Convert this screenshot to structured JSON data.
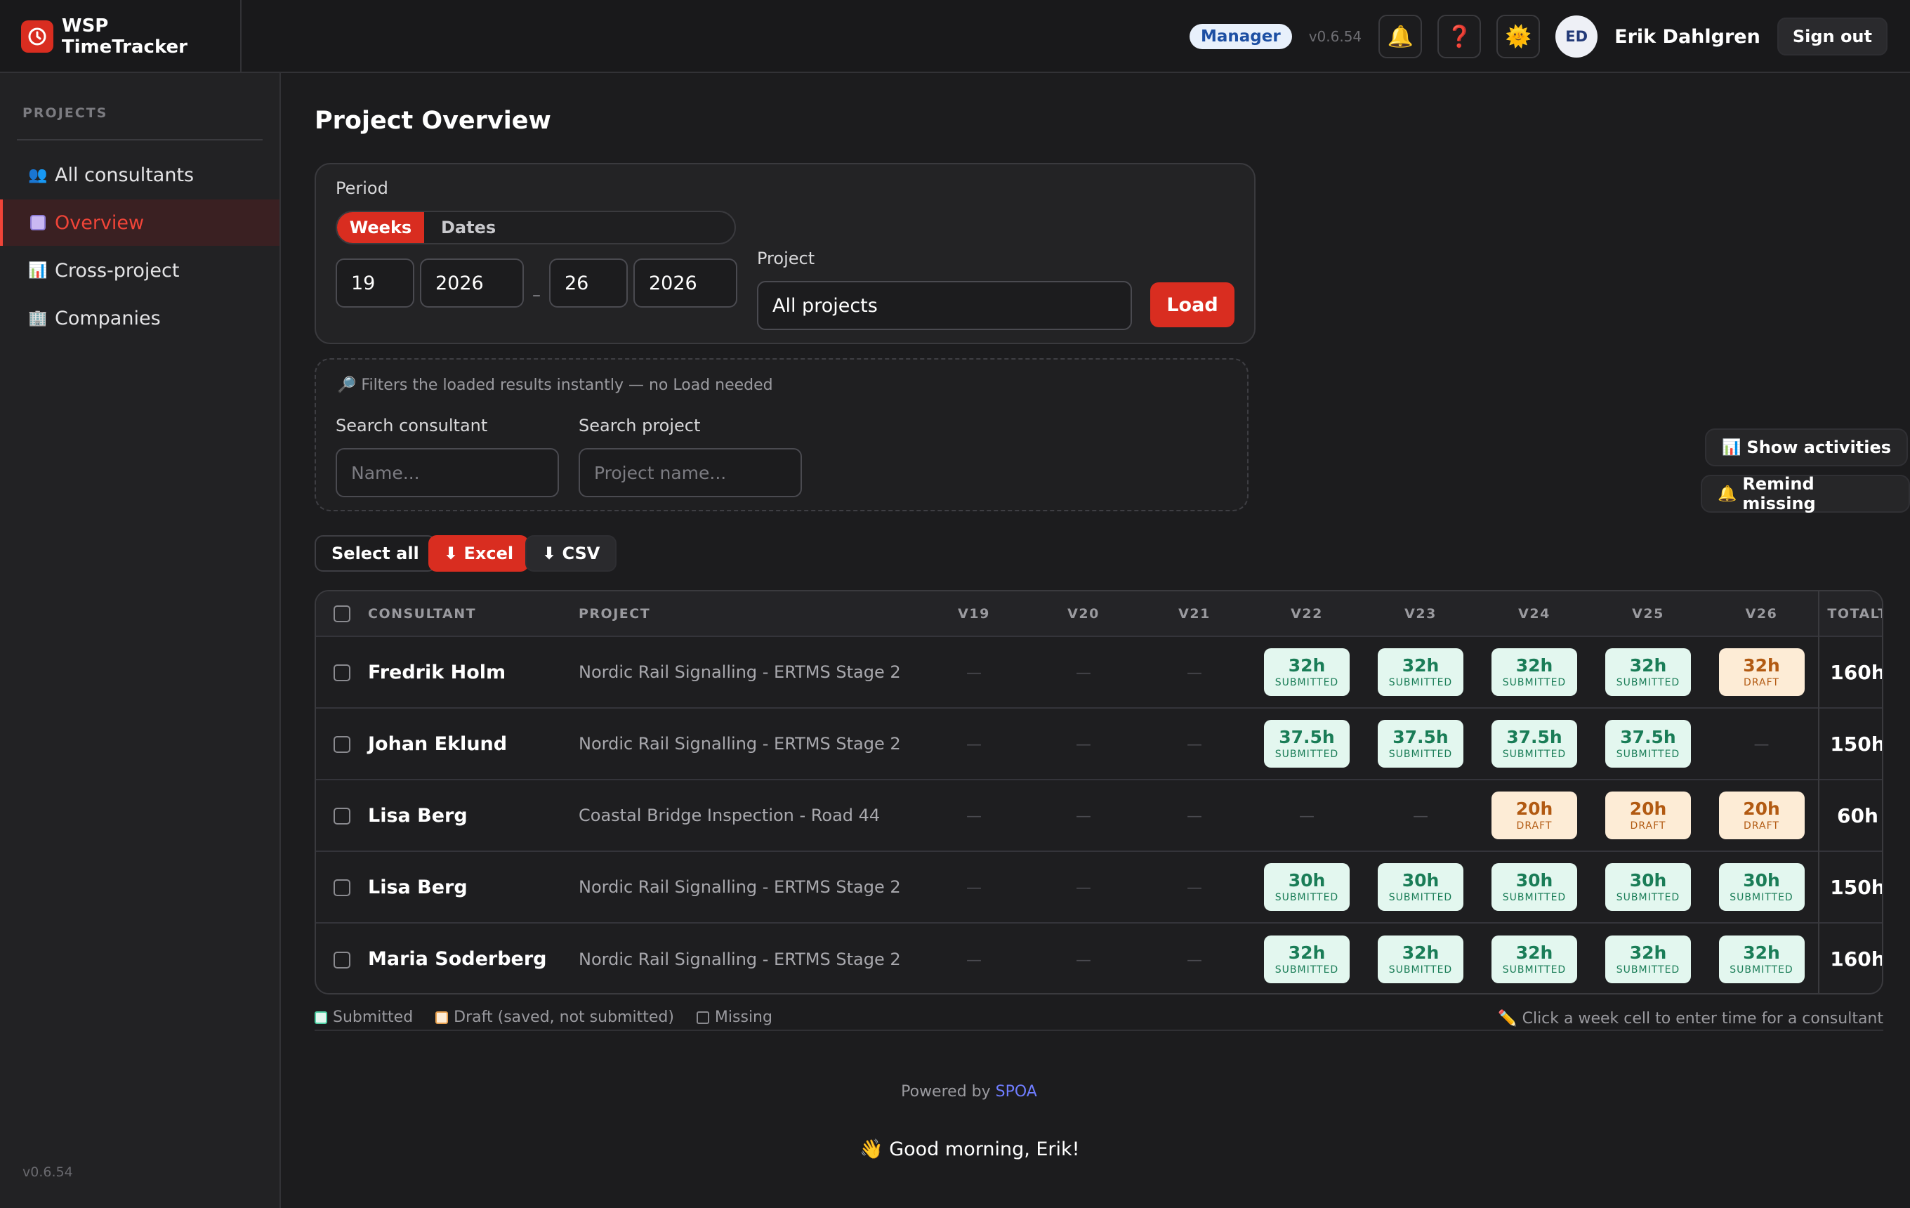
{
  "app": {
    "name": "WSP TimeTracker",
    "role": "Manager",
    "version": "v0.6.54",
    "user_initials": "ED",
    "user_name": "Erik Dahlgren",
    "sign_out": "Sign out"
  },
  "icons": {
    "notifications": "bell-icon",
    "help": "question-icon",
    "theme": "sun-icon"
  },
  "colors": {
    "accent": "#d92d20",
    "submitted_bg": "#e3f7ef",
    "submitted_fg": "#1a7d57",
    "draft_bg": "#fdecd6",
    "draft_fg": "#b25a12",
    "role_badge": "#e8f0fb"
  },
  "sidebar": {
    "heading": "PROJECTS",
    "items": [
      {
        "label": "All consultants",
        "icon": "people-icon",
        "active": false
      },
      {
        "label": "Overview",
        "icon": "square-icon",
        "active": true
      },
      {
        "label": "Cross-project",
        "icon": "bar-chart-icon",
        "active": false
      },
      {
        "label": "Companies",
        "icon": "building-icon",
        "active": false
      }
    ],
    "version": "v0.6.54"
  },
  "page": {
    "title": "Project Overview"
  },
  "period": {
    "label": "Period",
    "mode_weeks": "Weeks",
    "mode_dates": "Dates",
    "from_week": "19",
    "from_year": "2026",
    "separator": "–",
    "to_week": "26",
    "to_year": "2026",
    "project_label": "Project",
    "project_value": "All projects",
    "load": "Load"
  },
  "filters": {
    "hint": "Filters the loaded results instantly — no Load needed",
    "consultant_label": "Search consultant",
    "consultant_placeholder": "Name...",
    "project_label": "Search project",
    "project_placeholder": "Project name..."
  },
  "actions": {
    "show_activities": "Show activities",
    "remind_missing": "Remind missing",
    "select_all": "Select all",
    "excel": "⬇ Excel",
    "csv": "⬇ CSV"
  },
  "table": {
    "headers": {
      "consultant": "CONSULTANT",
      "project": "PROJECT",
      "weeks": [
        "V19",
        "V20",
        "V21",
        "V22",
        "V23",
        "V24",
        "V25",
        "V26"
      ],
      "total": "TOTALT"
    },
    "empty_mark": "—",
    "rows": [
      {
        "name": "Fredrik Holm",
        "project": "Nordic Rail Signalling - ERTMS Stage 2",
        "weeks": [
          null,
          null,
          null,
          {
            "hours": "32h",
            "status": "SUBMITTED"
          },
          {
            "hours": "32h",
            "status": "SUBMITTED"
          },
          {
            "hours": "32h",
            "status": "SUBMITTED"
          },
          {
            "hours": "32h",
            "status": "SUBMITTED"
          },
          {
            "hours": "32h",
            "status": "DRAFT"
          }
        ],
        "total": "160h"
      },
      {
        "name": "Johan Eklund",
        "project": "Nordic Rail Signalling - ERTMS Stage 2",
        "weeks": [
          null,
          null,
          null,
          {
            "hours": "37.5h",
            "status": "SUBMITTED"
          },
          {
            "hours": "37.5h",
            "status": "SUBMITTED"
          },
          {
            "hours": "37.5h",
            "status": "SUBMITTED"
          },
          {
            "hours": "37.5h",
            "status": "SUBMITTED"
          },
          null
        ],
        "total": "150h"
      },
      {
        "name": "Lisa Berg",
        "project": "Coastal Bridge Inspection - Road 44",
        "weeks": [
          null,
          null,
          null,
          null,
          null,
          {
            "hours": "20h",
            "status": "DRAFT"
          },
          {
            "hours": "20h",
            "status": "DRAFT"
          },
          {
            "hours": "20h",
            "status": "DRAFT"
          }
        ],
        "total": "60h"
      },
      {
        "name": "Lisa Berg",
        "project": "Nordic Rail Signalling - ERTMS Stage 2",
        "weeks": [
          null,
          null,
          null,
          {
            "hours": "30h",
            "status": "SUBMITTED"
          },
          {
            "hours": "30h",
            "status": "SUBMITTED"
          },
          {
            "hours": "30h",
            "status": "SUBMITTED"
          },
          {
            "hours": "30h",
            "status": "SUBMITTED"
          },
          {
            "hours": "30h",
            "status": "SUBMITTED"
          }
        ],
        "total": "150h"
      },
      {
        "name": "Maria Soderberg",
        "project": "Nordic Rail Signalling - ERTMS Stage 2",
        "weeks": [
          null,
          null,
          null,
          {
            "hours": "32h",
            "status": "SUBMITTED"
          },
          {
            "hours": "32h",
            "status": "SUBMITTED"
          },
          {
            "hours": "32h",
            "status": "SUBMITTED"
          },
          {
            "hours": "32h",
            "status": "SUBMITTED"
          },
          {
            "hours": "32h",
            "status": "SUBMITTED"
          }
        ],
        "total": "160h"
      }
    ]
  },
  "legend": {
    "submitted": "Submitted",
    "draft": "Draft (saved, not submitted)",
    "missing": "Missing",
    "hint": "Click a week cell to enter time for a consultant"
  },
  "footer": {
    "powered_prefix": "Powered by",
    "powered_brand": "SPOA",
    "greeting": "Good morning, Erik!"
  }
}
